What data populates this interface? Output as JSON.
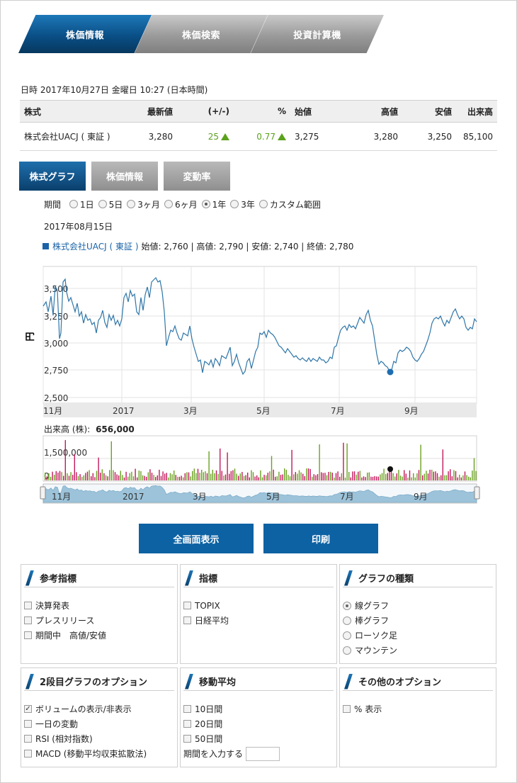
{
  "top_tabs": [
    {
      "label": "株価情報",
      "active": true
    },
    {
      "label": "株価検索",
      "active": false
    },
    {
      "label": "投資計算機",
      "active": false
    }
  ],
  "datetime": "日時 2017年10月27日 金曜日 10:27 (日本時間)",
  "table": {
    "headers": {
      "name": "株式",
      "last": "最新値",
      "change": "(+/-)",
      "pct": "%",
      "open": "始値",
      "high": "高値",
      "low": "安値",
      "volume": "出来高"
    },
    "row": {
      "name": "株式会社UACJ ( 東証 )",
      "last": "3,280",
      "change": "25",
      "pct": "0.77",
      "open": "3,275",
      "high": "3,280",
      "low": "3,250",
      "volume": "85,100"
    }
  },
  "sub_tabs": [
    {
      "label": "株式グラフ",
      "active": true
    },
    {
      "label": "株価情報",
      "active": false
    },
    {
      "label": "変動率",
      "active": false
    }
  ],
  "period": {
    "label": "期間",
    "options": [
      "1日",
      "5日",
      "3ヶ月",
      "6ヶ月",
      "1年",
      "3年",
      "カスタム範囲"
    ],
    "selected": "1年"
  },
  "point": {
    "date": "2017年08月15日",
    "name": "株式会社UACJ ( 東証 )",
    "ohlc": "始値: 2,760 | 高値: 2,790 | 安値: 2,740 | 終値: 2,780"
  },
  "price_chart": {
    "y_axis_title": "円",
    "y_ticks": [
      "3,500",
      "3,250",
      "3,000",
      "2,750",
      "2,500"
    ],
    "x_ticks": [
      "11月",
      "2017",
      "3月",
      "5月",
      "7月",
      "9月"
    ]
  },
  "volume": {
    "label": "出来高 (株):",
    "value": "656,000",
    "y_ticks": [
      "1,500,000",
      "0"
    ]
  },
  "navigator_ticks": [
    "11月",
    "2017",
    "3月",
    "5月",
    "7月",
    "9月"
  ],
  "buttons": {
    "fullscreen": "全画面表示",
    "print": "印刷"
  },
  "panels": {
    "reference": {
      "title": "参考指標",
      "items": [
        {
          "label": "決算発表",
          "checked": false
        },
        {
          "label": "プレスリリース",
          "checked": false
        },
        {
          "label": "期間中　高値/安値",
          "checked": false
        }
      ]
    },
    "indicators": {
      "title": "指標",
      "items": [
        {
          "label": "TOPIX",
          "checked": false
        },
        {
          "label": "日経平均",
          "checked": false
        }
      ]
    },
    "graph_type": {
      "title": "グラフの種類",
      "items": [
        {
          "label": "線グラフ",
          "selected": true
        },
        {
          "label": "棒グラフ",
          "selected": false
        },
        {
          "label": "ローソク足",
          "selected": false
        },
        {
          "label": "マウンテン",
          "selected": false
        }
      ]
    },
    "second_graph": {
      "title": "2段目グラフのオプション",
      "items": [
        {
          "label": "ボリュームの表示/非表示",
          "checked": true
        },
        {
          "label": "一日の変動",
          "checked": false
        },
        {
          "label": "RSI (相対指数)",
          "checked": false
        },
        {
          "label": "MACD (移動平均収束拡散法)",
          "checked": false
        }
      ]
    },
    "moving_avg": {
      "title": "移動平均",
      "items": [
        {
          "label": "10日間",
          "checked": false
        },
        {
          "label": "20日間",
          "checked": false
        },
        {
          "label": "50日間",
          "checked": false
        }
      ],
      "custom_label": "期間を入力する"
    },
    "other": {
      "title": "その他のオプション",
      "items": [
        {
          "label": "% 表示",
          "checked": false
        }
      ]
    }
  },
  "colors": {
    "brand": "#0d62a3",
    "up": "#5aa11c",
    "line": "#2f76a8",
    "vol_up": "#6aa121",
    "vol_down": "#c2185b",
    "area": "#9cc3da"
  }
}
